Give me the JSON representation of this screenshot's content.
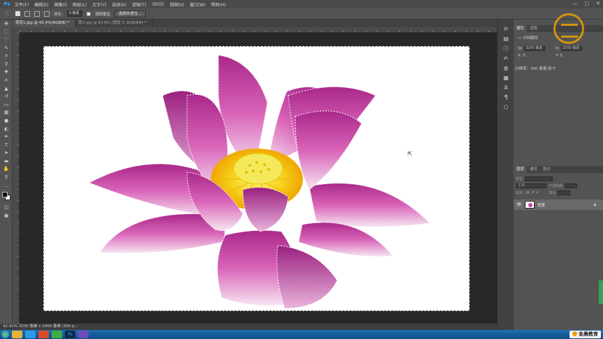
{
  "app": {
    "logo": "Ps",
    "menu": [
      "文件(F)",
      "编辑(E)",
      "图像(I)",
      "图层(L)",
      "文字(Y)",
      "选择(S)",
      "滤镜(T)",
      "3D(D)",
      "视图(V)",
      "窗口(W)",
      "帮助(H)"
    ],
    "window_controls": [
      "—",
      "□",
      "✕"
    ]
  },
  "options": {
    "feather_label": "羽化:",
    "feather_value": "0 像素",
    "antialias_label": "消除锯齿",
    "select_mask_button": "选择并遮住..."
  },
  "tabs": [
    {
      "label": "荷花1.jpg @ 42.4%(RGB/8) *",
      "active": true
    },
    {
      "label": "荷2.jpg @ 63.8% (图层 3, RGB/8#) *",
      "active": false
    }
  ],
  "status": {
    "text": "42.41%   3200 像素 x 2000 像素 (300 p..."
  },
  "properties": {
    "tabs": [
      "属性",
      "调整"
    ],
    "doc_title": "文档属性",
    "w_label": "W:",
    "w_value": "3200 像素",
    "h_label": "H:",
    "h_value": "2000 像素",
    "x_label": "X:",
    "x_value": "0",
    "y_label": "Y:",
    "y_value": "0",
    "resolution": "分辨率：300 像素/英寸"
  },
  "layers": {
    "tabs": [
      "图层",
      "通道",
      "路径"
    ],
    "kind_label": "类型",
    "mode_label": "正常",
    "opacity_label": "不透明度",
    "lock_label": "锁定:",
    "fill_label": "填充",
    "layer_name": "背景"
  },
  "brand": {
    "text": "金晨教育"
  },
  "colors": {
    "accent_ps": "#31a8ff",
    "flower_magenta": "#b5338f",
    "flower_pink": "#e88ad0",
    "stamen_yellow": "#f7d21e",
    "logo_gold": "#e8a200"
  },
  "tool_icons": [
    "move-icon",
    "marquee-icon",
    "lasso-icon",
    "quick-select-icon",
    "crop-icon",
    "eyedropper-icon",
    "healing-icon",
    "brush-icon",
    "stamp-icon",
    "history-brush-icon",
    "eraser-icon",
    "gradient-icon",
    "blur-icon",
    "dodge-icon",
    "pen-icon",
    "type-icon",
    "path-select-icon",
    "shape-icon",
    "hand-icon",
    "zoom-icon"
  ]
}
